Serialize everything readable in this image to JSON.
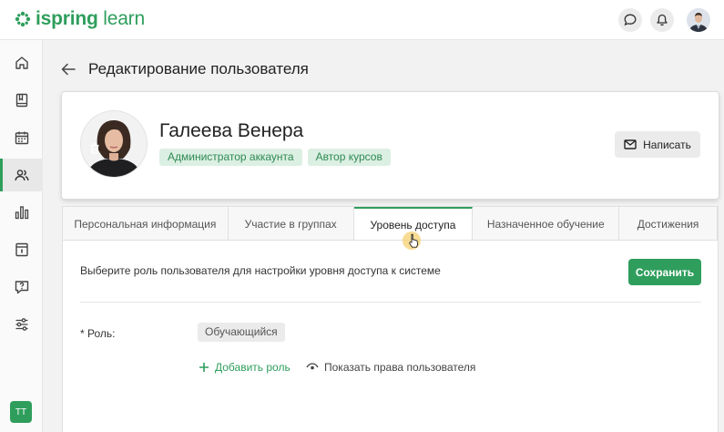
{
  "header": {
    "logo_text_bold": "ispring",
    "logo_text_light": " learn",
    "brand_color": "#2f9e5c",
    "icons": [
      "chat-icon",
      "bell-icon"
    ]
  },
  "sidebar": {
    "items": [
      {
        "name": "home-icon",
        "active": false
      },
      {
        "name": "book-icon",
        "active": false
      },
      {
        "name": "calendar-icon",
        "active": false
      },
      {
        "name": "users-icon",
        "active": true
      },
      {
        "name": "bar-chart-icon",
        "active": false
      },
      {
        "name": "calendar-card-icon",
        "active": false
      },
      {
        "name": "question-icon",
        "active": false
      },
      {
        "name": "sliders-icon",
        "active": false
      }
    ],
    "user_initials": "ТТ"
  },
  "page": {
    "title": "Редактирование пользователя"
  },
  "profile": {
    "name": "Галеева Венера",
    "tags": [
      "Администратор аккаунта",
      "Автор курсов"
    ],
    "write_label": "Написать"
  },
  "tabs": [
    {
      "label": "Персональная информация",
      "active": false
    },
    {
      "label": "Участие в группах",
      "active": false
    },
    {
      "label": "Уровень доступа",
      "active": true
    },
    {
      "label": "Назначенное обучение",
      "active": false
    },
    {
      "label": "Достижения",
      "active": false
    }
  ],
  "access": {
    "description": "Выберите роль пользователя для настройки уровня доступа к системе",
    "save_label": "Сохранить",
    "role_label": "* Роль:",
    "role_value": "Обучающийся",
    "add_role_label": "Добавить роль",
    "show_rights_label": "Показать права пользователя"
  }
}
